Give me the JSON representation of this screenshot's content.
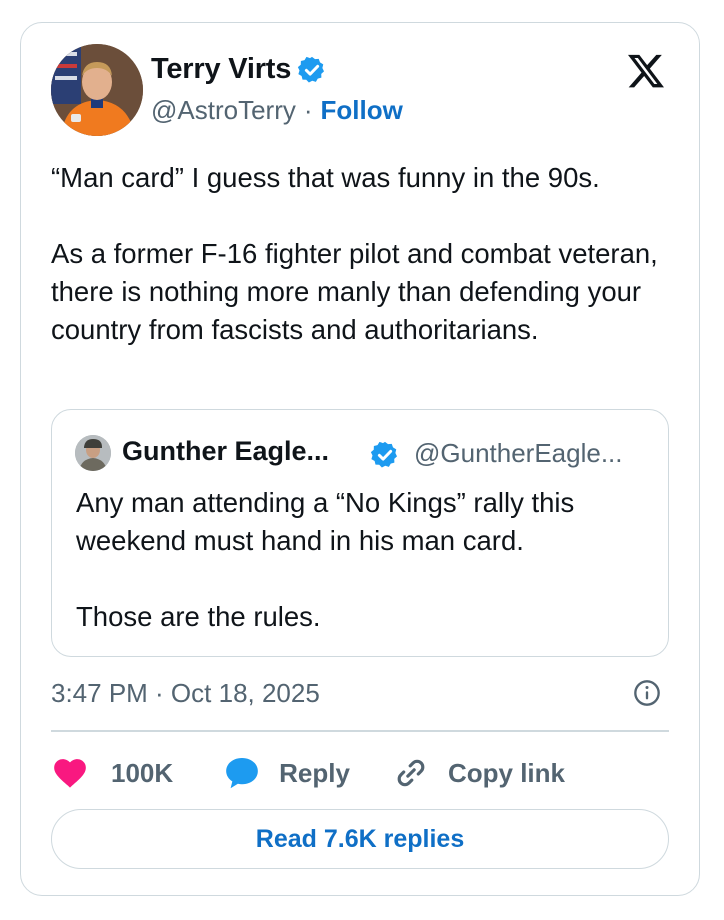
{
  "author": {
    "name": "Terry Virts",
    "handle": "@AstroTerry",
    "separator": "·",
    "follow_label": "Follow"
  },
  "tweet": {
    "text": "“Man card”   I guess that was funny in the 90s.\n\nAs a former F-16 fighter pilot and combat veteran, there is nothing more manly than defending your country from fascists and authoritarians."
  },
  "quoted_tweet": {
    "name": "Gunther Eagle...",
    "handle": "@GuntherEagle...",
    "text": "Any man attending a “No Kings” rally this weekend must hand in his man card.\n\nThose are the rules."
  },
  "timestamp": "3:47 PM · Oct 18, 2025",
  "actions": {
    "like_count": "100K",
    "reply_label": "Reply",
    "copy_label": "Copy link"
  },
  "read_replies_label": "Read 7.6K replies",
  "icons": {
    "verified": "verified-badge-icon",
    "logo": "x-logo-icon",
    "info": "info-icon",
    "like": "heart-icon",
    "reply": "speech-bubble-icon",
    "copy": "link-icon"
  },
  "colors": {
    "accent": "#0f6fc6",
    "verified": "#1d9bf0",
    "like": "#f91880",
    "muted": "#536471",
    "border": "#cfd9de"
  }
}
